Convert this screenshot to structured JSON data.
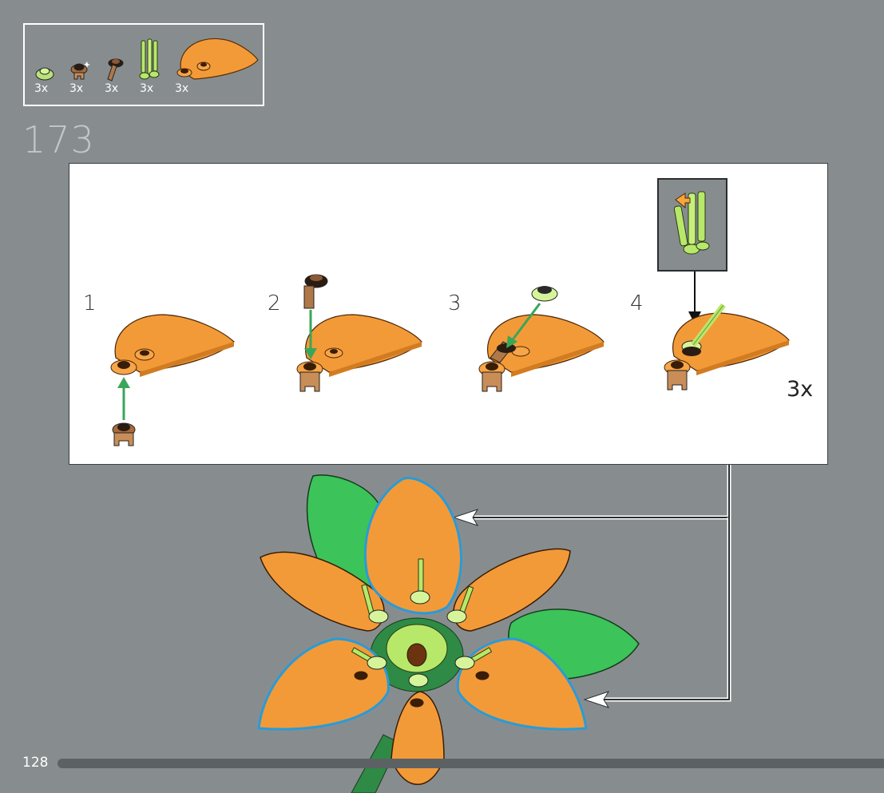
{
  "page": {
    "step_number": "173",
    "page_number": "128",
    "progress_fraction": 1.0
  },
  "parts": [
    {
      "icon": "lime-round-plate-icon",
      "qty": "3x"
    },
    {
      "icon": "brown-clip-plate-icon",
      "qty": "3x"
    },
    {
      "icon": "brown-bar-connector-icon",
      "qty": "3x"
    },
    {
      "icon": "lime-stem-bars-icon",
      "qty": "3x"
    },
    {
      "icon": "orange-petal-icon",
      "qty": "3x"
    }
  ],
  "substeps": [
    {
      "number": "1"
    },
    {
      "number": "2"
    },
    {
      "number": "3"
    },
    {
      "number": "4"
    }
  ],
  "panel": {
    "multiplier": "3x"
  },
  "colors": {
    "background": "#878d8f",
    "petal_orange": "#f39a38",
    "leaf_green": "#3cc35a",
    "lime": "#c9ef78",
    "brown": "#8c5a32",
    "arrow_green": "#3aa65a"
  }
}
